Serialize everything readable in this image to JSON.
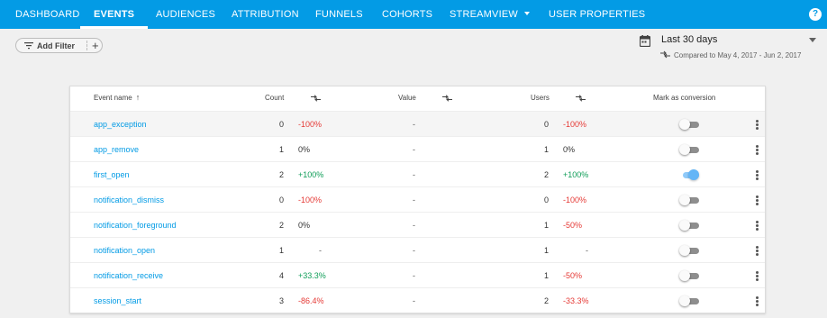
{
  "nav": {
    "tabs": [
      {
        "label": "DASHBOARD",
        "active": false
      },
      {
        "label": "EVENTS",
        "active": true
      },
      {
        "label": "AUDIENCES",
        "active": false
      },
      {
        "label": "ATTRIBUTION",
        "active": false
      },
      {
        "label": "FUNNELS",
        "active": false
      },
      {
        "label": "COHORTS",
        "active": false
      },
      {
        "label": "STREAMVIEW",
        "active": false,
        "has_dropdown": true
      },
      {
        "label": "USER PROPERTIES",
        "active": false
      }
    ],
    "help_label": "?"
  },
  "filter": {
    "label": "Add Filter",
    "add_label": "+"
  },
  "date": {
    "range_label": "Last 30 days",
    "compare_label": "Compared to May 4, 2017 - Jun 2, 2017"
  },
  "table": {
    "headers": {
      "event_name": "Event name",
      "count": "Count",
      "value": "Value",
      "users": "Users",
      "conversion": "Mark as conversion"
    },
    "sort_icon": "↑",
    "rows": [
      {
        "name": "app_exception",
        "count": "0",
        "count_change": "-100%",
        "value": "-",
        "users": "0",
        "users_change": "-100%",
        "conversion": false,
        "highlight": true
      },
      {
        "name": "app_remove",
        "count": "1",
        "count_change": "0%",
        "value": "-",
        "users": "1",
        "users_change": "0%",
        "conversion": false
      },
      {
        "name": "first_open",
        "count": "2",
        "count_change": "+100%",
        "value": "-",
        "users": "2",
        "users_change": "+100%",
        "conversion": true
      },
      {
        "name": "notification_dismiss",
        "count": "0",
        "count_change": "-100%",
        "value": "-",
        "users": "0",
        "users_change": "-100%",
        "conversion": false
      },
      {
        "name": "notification_foreground",
        "count": "2",
        "count_change": "0%",
        "value": "-",
        "users": "1",
        "users_change": "-50%",
        "conversion": false
      },
      {
        "name": "notification_open",
        "count": "1",
        "count_change": "-",
        "value": "-",
        "users": "1",
        "users_change": "-",
        "conversion": false
      },
      {
        "name": "notification_receive",
        "count": "4",
        "count_change": "+33.3%",
        "value": "-",
        "users": "1",
        "users_change": "-50%",
        "conversion": false
      },
      {
        "name": "session_start",
        "count": "3",
        "count_change": "-86.4%",
        "value": "-",
        "users": "2",
        "users_change": "-33.3%",
        "conversion": false
      }
    ]
  },
  "colors": {
    "nav_bg": "#039be5",
    "link": "#039be5",
    "negative": "#e53935",
    "positive": "#0f9d58",
    "toggle_on": "#64b5f6"
  },
  "icons": {
    "filter": "filter-list-icon",
    "add": "plus-icon",
    "calendar": "calendar-icon",
    "compare": "compare-arrows-icon",
    "sort": "arrow-up-icon",
    "row_menu": "more-vert-icon",
    "help": "help-icon"
  }
}
